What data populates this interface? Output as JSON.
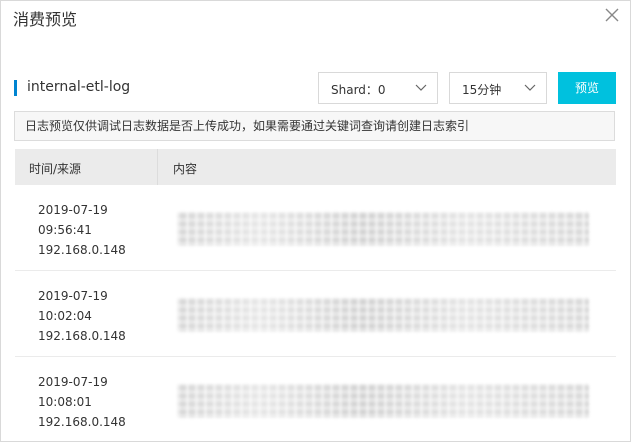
{
  "dialog": {
    "title": "消费预览",
    "close_icon": "close-icon"
  },
  "logstore": {
    "name": "internal-etl-log",
    "accent": "#0084d1"
  },
  "controls": {
    "shard": {
      "selected": "Shard：0"
    },
    "time_range": {
      "selected": "15分钟"
    },
    "preview_label": "预览",
    "button_color": "#00c1de"
  },
  "notice": "日志预览仅供调试日志数据是否上传成功，如果需要通过关键词查询请创建日志索引",
  "table": {
    "columns": [
      "时间/来源",
      "内容"
    ],
    "rows": [
      {
        "date": "2019-07-19",
        "time": "09:56:41",
        "source": "192.168.0.148"
      },
      {
        "date": "2019-07-19",
        "time": "10:02:04",
        "source": "192.168.0.148"
      },
      {
        "date": "2019-07-19",
        "time": "10:08:01",
        "source": "192.168.0.148"
      }
    ]
  }
}
